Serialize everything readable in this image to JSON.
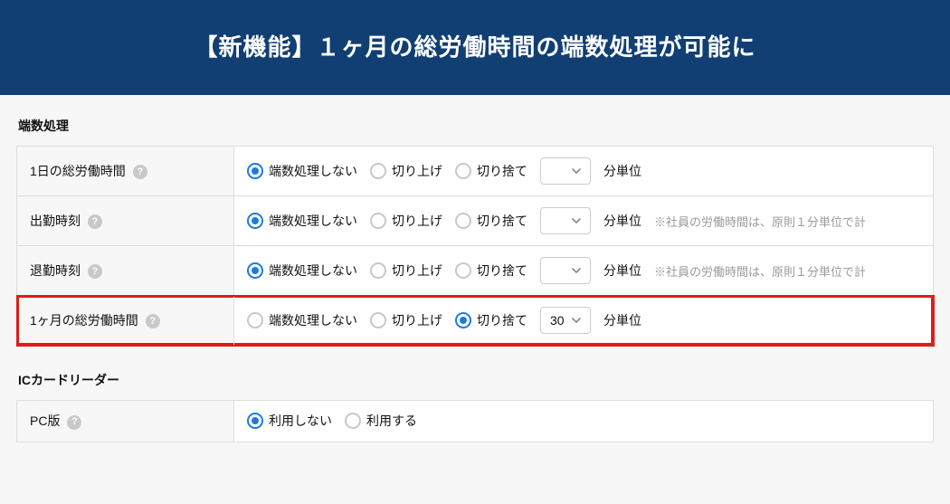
{
  "hero": {
    "title": "【新機能】１ヶ月の総労働時間の端数処理が可能に"
  },
  "sections": {
    "rounding": {
      "title": "端数処理",
      "options": {
        "none": "端数処理しない",
        "round_up": "切り上げ",
        "round_down": "切り捨て",
        "unit_suffix": "分単位"
      },
      "note_text": "※社員の労働時間は、原則１分単位で計",
      "rows": {
        "daily_total": {
          "label": "1日の総労働時間",
          "selected": "none",
          "minutes": "",
          "note": false,
          "highlight": false
        },
        "clock_in": {
          "label": "出勤時刻",
          "selected": "none",
          "minutes": "",
          "note": true,
          "highlight": false
        },
        "clock_out": {
          "label": "退勤時刻",
          "selected": "none",
          "minutes": "",
          "note": true,
          "highlight": false
        },
        "monthly_total": {
          "label": "1ヶ月の総労働時間",
          "selected": "round_down",
          "minutes": "30",
          "note": false,
          "highlight": true
        }
      }
    },
    "ic_reader": {
      "title": "ICカードリーダー",
      "row_label": "PC版",
      "options": {
        "off": "利用しない",
        "on": "利用する"
      },
      "selected": "off"
    }
  }
}
